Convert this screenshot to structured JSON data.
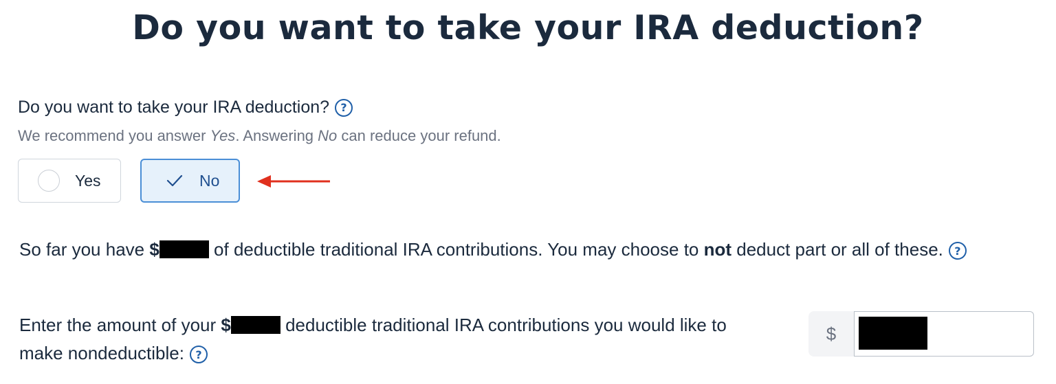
{
  "header": {
    "title": "Do you want to take your IRA deduction?"
  },
  "question": {
    "label": "Do you want to take your IRA deduction?",
    "help": "?",
    "recommend_prefix": "We recommend you answer ",
    "recommend_yes": "Yes",
    "recommend_mid": ". Answering ",
    "recommend_no": "No",
    "recommend_suffix": " can reduce your refund.",
    "options": [
      {
        "label": "Yes",
        "selected": false
      },
      {
        "label": "No",
        "selected": true
      }
    ]
  },
  "contributions": {
    "text_1": "So far you have ",
    "currency": "$",
    "text_2": " of deductible traditional IRA contributions. You may choose to ",
    "emphasis": "not",
    "text_3": " deduct part or all of these.",
    "help": "?"
  },
  "nondeductible": {
    "text_1": "Enter the amount of your ",
    "currency": "$",
    "text_2": " deductible traditional IRA contributions you would like to make nondeductible:",
    "help": "?",
    "input_prefix": "$"
  },
  "colors": {
    "title": "#1b2a3d",
    "accent": "#1f5fa8",
    "selected_bg": "#e6f1fb",
    "selected_border": "#4a8ed6",
    "arrow": "#e0301e"
  }
}
